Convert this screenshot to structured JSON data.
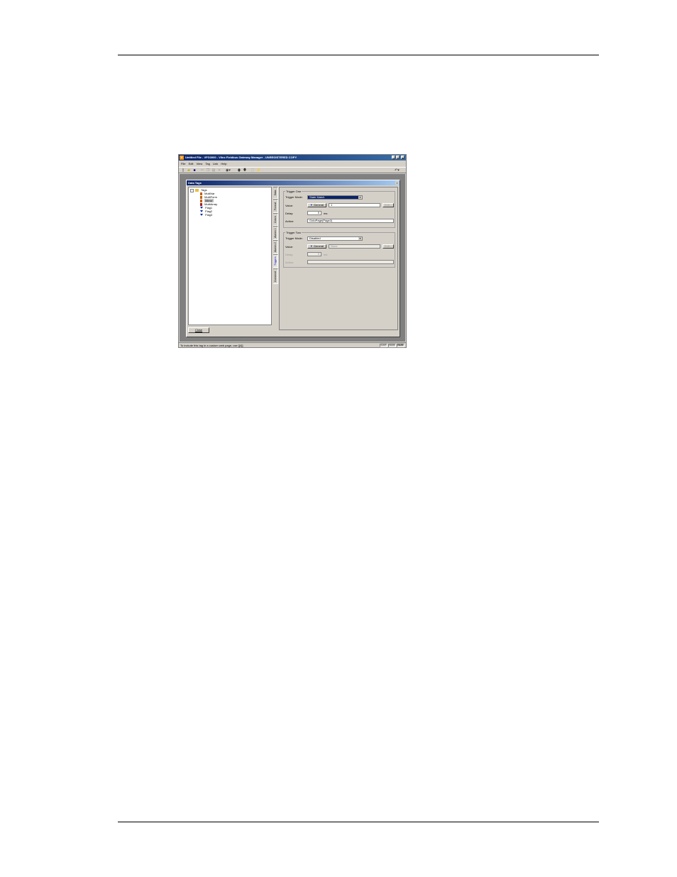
{
  "window": {
    "title": "Untitled File - VFG3000 - Vlinx Fieldbus Gateway Manager - UNREGISTERED COPY",
    "app_icon": "V",
    "minimize_glyph": "_",
    "maximize_glyph": "□",
    "close_glyph": "×"
  },
  "menu": [
    "File",
    "Edit",
    "View",
    "Tag",
    "Link",
    "Help"
  ],
  "toolbar": [
    "new-icon",
    "open-icon",
    "save-icon",
    "cut-icon",
    "copy-icon",
    "paste-icon",
    "delete-icon",
    "view-icon",
    "up-arrow-icon",
    "down-arrow-icon",
    "select-icon",
    "lightning-icon",
    "back-icon"
  ],
  "dialog": {
    "title": "Data Tags",
    "close_glyph": "×"
  },
  "tree": {
    "root_label": "Tags",
    "items": [
      {
        "label": "MultiVar",
        "icon": "integer-tag-icon",
        "selected": false
      },
      {
        "label": "MultiForm",
        "icon": "integer-tag-icon",
        "selected": false
      },
      {
        "label": "Mirror",
        "icon": "integer-tag-icon",
        "selected": true
      },
      {
        "label": "MultiArray",
        "icon": "array-tag-icon",
        "selected": false
      },
      {
        "label": "Flag1",
        "icon": "flag-tag-icon",
        "selected": false
      },
      {
        "label": "Flag2",
        "icon": "flag-tag-icon",
        "selected": false
      },
      {
        "label": "Flag3",
        "icon": "flag-tag-icon",
        "selected": false
      }
    ]
  },
  "close_button": "Close",
  "tabs": [
    {
      "label": "Data",
      "active": false
    },
    {
      "label": "Format",
      "active": false
    },
    {
      "label": "Colors",
      "active": false
    },
    {
      "label": "Alarms 1",
      "active": false
    },
    {
      "label": "Alarms 2",
      "active": false
    },
    {
      "label": "Triggers",
      "active": true
    },
    {
      "label": "Comment",
      "active": false
    }
  ],
  "trigger_one": {
    "group_label": "Trigger One",
    "mode_label": "Trigger Mode:",
    "mode_value": "State Match",
    "value_label": "Value:",
    "general_button": "General",
    "value": "1",
    "edit_button": "Edit...",
    "delay_label": "Delay:",
    "delay_value": "0",
    "delay_unit": "ms",
    "action_label": "Action:",
    "action_value": "GotoPage(Page2)"
  },
  "trigger_two": {
    "group_label": "Trigger Two",
    "mode_label": "Trigger Mode:",
    "mode_value": "Disabled",
    "value_label": "Value:",
    "general_button": "General",
    "value": "None",
    "edit_button": "Edit...",
    "delay_label": "Delay:",
    "delay_value": "0",
    "delay_unit": "ms",
    "action_label": "Action:",
    "action_value": ""
  },
  "statusbar": {
    "text": "To include this tag in a custom web page, use [[4]]",
    "cell1": "CAP",
    "cell2": "NUM",
    "cell3": "NUM"
  }
}
